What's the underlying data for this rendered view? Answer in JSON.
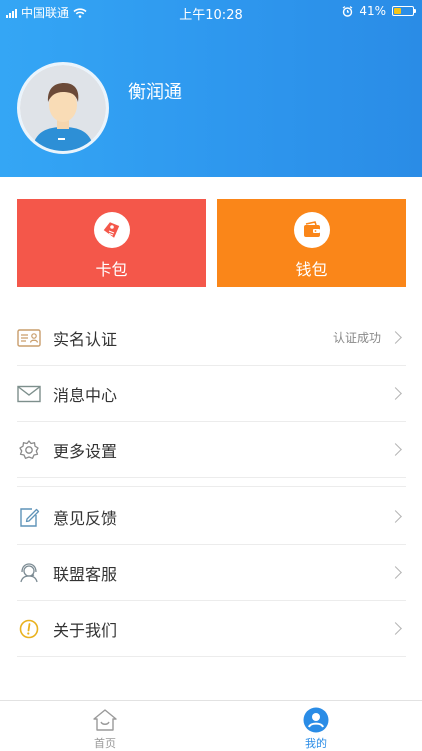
{
  "status_bar": {
    "carrier": "中国联通",
    "time": "上午10:28",
    "battery_percent": "41%",
    "battery_level": 0.41
  },
  "profile": {
    "username": "衡润通"
  },
  "tiles": [
    {
      "label": "卡包",
      "icon": "tag-icon",
      "color": "#f4574a"
    },
    {
      "label": "钱包",
      "icon": "wallet-icon",
      "color": "#fa8619"
    }
  ],
  "menu": [
    {
      "label": "实名认证",
      "status": "认证成功",
      "icon": "id-card-icon"
    },
    {
      "label": "消息中心",
      "status": "",
      "icon": "envelope-icon"
    },
    {
      "label": "更多设置",
      "status": "",
      "icon": "gear-icon"
    },
    {
      "label": "意见反馈",
      "status": "",
      "icon": "edit-icon"
    },
    {
      "label": "联盟客服",
      "status": "",
      "icon": "headset-icon"
    },
    {
      "label": "关于我们",
      "status": "",
      "icon": "info-icon"
    }
  ],
  "tabbar": {
    "home_label": "首页",
    "mine_label": "我的",
    "active": "mine",
    "active_color": "#2a8ce6"
  }
}
